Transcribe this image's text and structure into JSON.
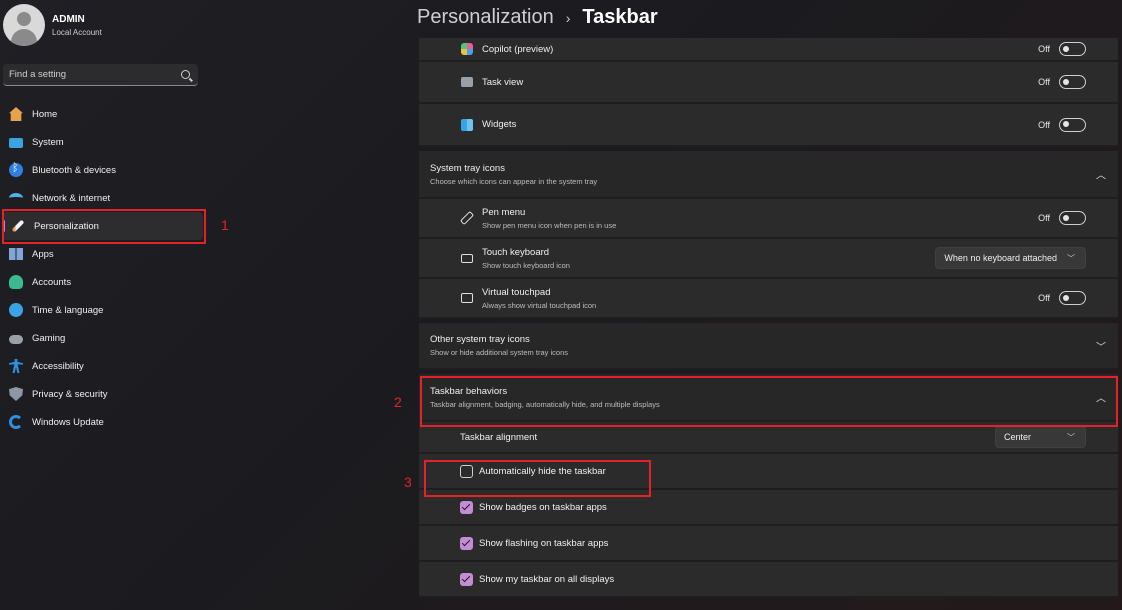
{
  "profile": {
    "name": "ADMIN",
    "subtitle": "Local Account"
  },
  "search": {
    "placeholder": "Find a setting"
  },
  "nav": [
    {
      "label": "Home",
      "icon": "home-icon"
    },
    {
      "label": "System",
      "icon": "system-icon"
    },
    {
      "label": "Bluetooth & devices",
      "icon": "bluetooth-icon"
    },
    {
      "label": "Network & internet",
      "icon": "wifi-icon"
    },
    {
      "label": "Personalization",
      "icon": "brush-icon",
      "active": true
    },
    {
      "label": "Apps",
      "icon": "apps-icon"
    },
    {
      "label": "Accounts",
      "icon": "person-icon"
    },
    {
      "label": "Time & language",
      "icon": "globe-icon"
    },
    {
      "label": "Gaming",
      "icon": "controller-icon"
    },
    {
      "label": "Accessibility",
      "icon": "accessibility-icon"
    },
    {
      "label": "Privacy & security",
      "icon": "shield-icon"
    },
    {
      "label": "Windows Update",
      "icon": "update-icon"
    }
  ],
  "breadcrumb": {
    "parent": "Personalization",
    "separator": "›",
    "current": "Taskbar"
  },
  "taskbar_items": [
    {
      "label": "Copilot (preview)",
      "state": "Off",
      "icon": "copilot-icon"
    },
    {
      "label": "Task view",
      "state": "Off",
      "icon": "task-view-icon"
    },
    {
      "label": "Widgets",
      "state": "Off",
      "icon": "widgets-icon"
    }
  ],
  "system_tray": {
    "title": "System tray icons",
    "subtitle": "Choose which icons can appear in the system tray",
    "items": [
      {
        "label": "Pen menu",
        "desc": "Show pen menu icon when pen is in use",
        "state": "Off",
        "icon": "pen-icon"
      },
      {
        "label": "Touch keyboard",
        "desc": "Show touch keyboard icon",
        "dropdown": "When no keyboard attached",
        "icon": "keyboard-icon"
      },
      {
        "label": "Virtual touchpad",
        "desc": "Always show virtual touchpad icon",
        "state": "Off",
        "icon": "touchpad-icon"
      }
    ]
  },
  "other_tray": {
    "title": "Other system tray icons",
    "subtitle": "Show or hide additional system tray icons"
  },
  "behaviors": {
    "title": "Taskbar behaviors",
    "subtitle": "Taskbar alignment, badging, automatically hide, and multiple displays",
    "alignment_label": "Taskbar alignment",
    "alignment_value": "Center",
    "checkboxes": [
      {
        "label": "Automatically hide the taskbar",
        "checked": false
      },
      {
        "label": "Show badges on taskbar apps",
        "checked": true
      },
      {
        "label": "Show flashing on taskbar apps",
        "checked": true
      },
      {
        "label": "Show my taskbar on all displays",
        "checked": true
      }
    ]
  },
  "annotations": [
    "1",
    "2",
    "3"
  ],
  "colors": {
    "accent": "#c58bd4",
    "highlight": "#e5222a"
  }
}
